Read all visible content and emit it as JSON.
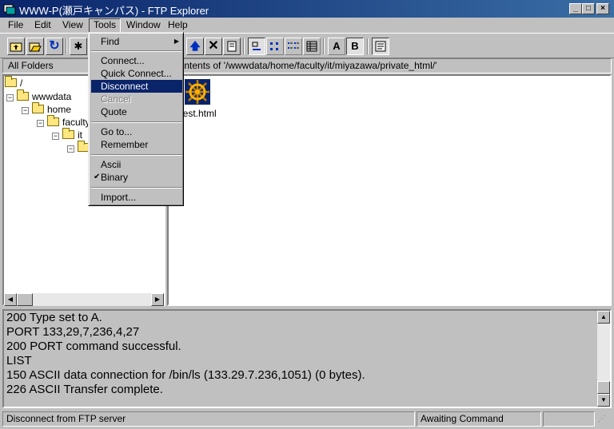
{
  "window": {
    "title": "WWW-P(瀬戸キャンパス) - FTP Explorer"
  },
  "menubar": {
    "items": [
      {
        "label": "File",
        "accel": "F"
      },
      {
        "label": "Edit",
        "accel": "E"
      },
      {
        "label": "View",
        "accel": "V"
      },
      {
        "label": "Tools",
        "accel": "T"
      },
      {
        "label": "Window",
        "accel": "W"
      },
      {
        "label": "Help",
        "accel": "H"
      }
    ]
  },
  "tools_menu": {
    "items": [
      {
        "label": "Find",
        "submenu": true
      },
      {
        "label": "Connect..."
      },
      {
        "label": "Quick Connect..."
      },
      {
        "label": "Disconnect",
        "highlighted": true
      },
      {
        "label": "Cancel",
        "disabled": true
      },
      {
        "label": "Quote"
      },
      {
        "label": "Go to..."
      },
      {
        "label": "Remember"
      },
      {
        "label": "Ascii"
      },
      {
        "label": "Binary",
        "checked": true
      },
      {
        "label": "Import..."
      }
    ]
  },
  "toolbar": {
    "font_a": "A",
    "font_b": "B"
  },
  "tree_header": "All Folders",
  "contents_header": "Contents of '/wwwdata/home/faculty/it/miyazawa/private_html/'",
  "tree": {
    "nodes": [
      "/",
      "wwwdata",
      "home",
      "faculty",
      "it"
    ]
  },
  "files": [
    {
      "name": "test.html",
      "icon": "ship-wheel-icon"
    }
  ],
  "log": {
    "lines": [
      "200 Type set to A.",
      "PORT 133,29,7,236,4,27",
      "200 PORT command successful.",
      "LIST",
      "150 ASCII data connection for /bin/ls (133.29.7.236,1051) (0 bytes).",
      "226 ASCII Transfer complete."
    ]
  },
  "status": {
    "message": "Disconnect from FTP server",
    "state": "Awaiting Command"
  },
  "colors": {
    "titlebar": "#0a246a",
    "menu_highlight": "#0a246a",
    "face": "#c0c0c0"
  }
}
